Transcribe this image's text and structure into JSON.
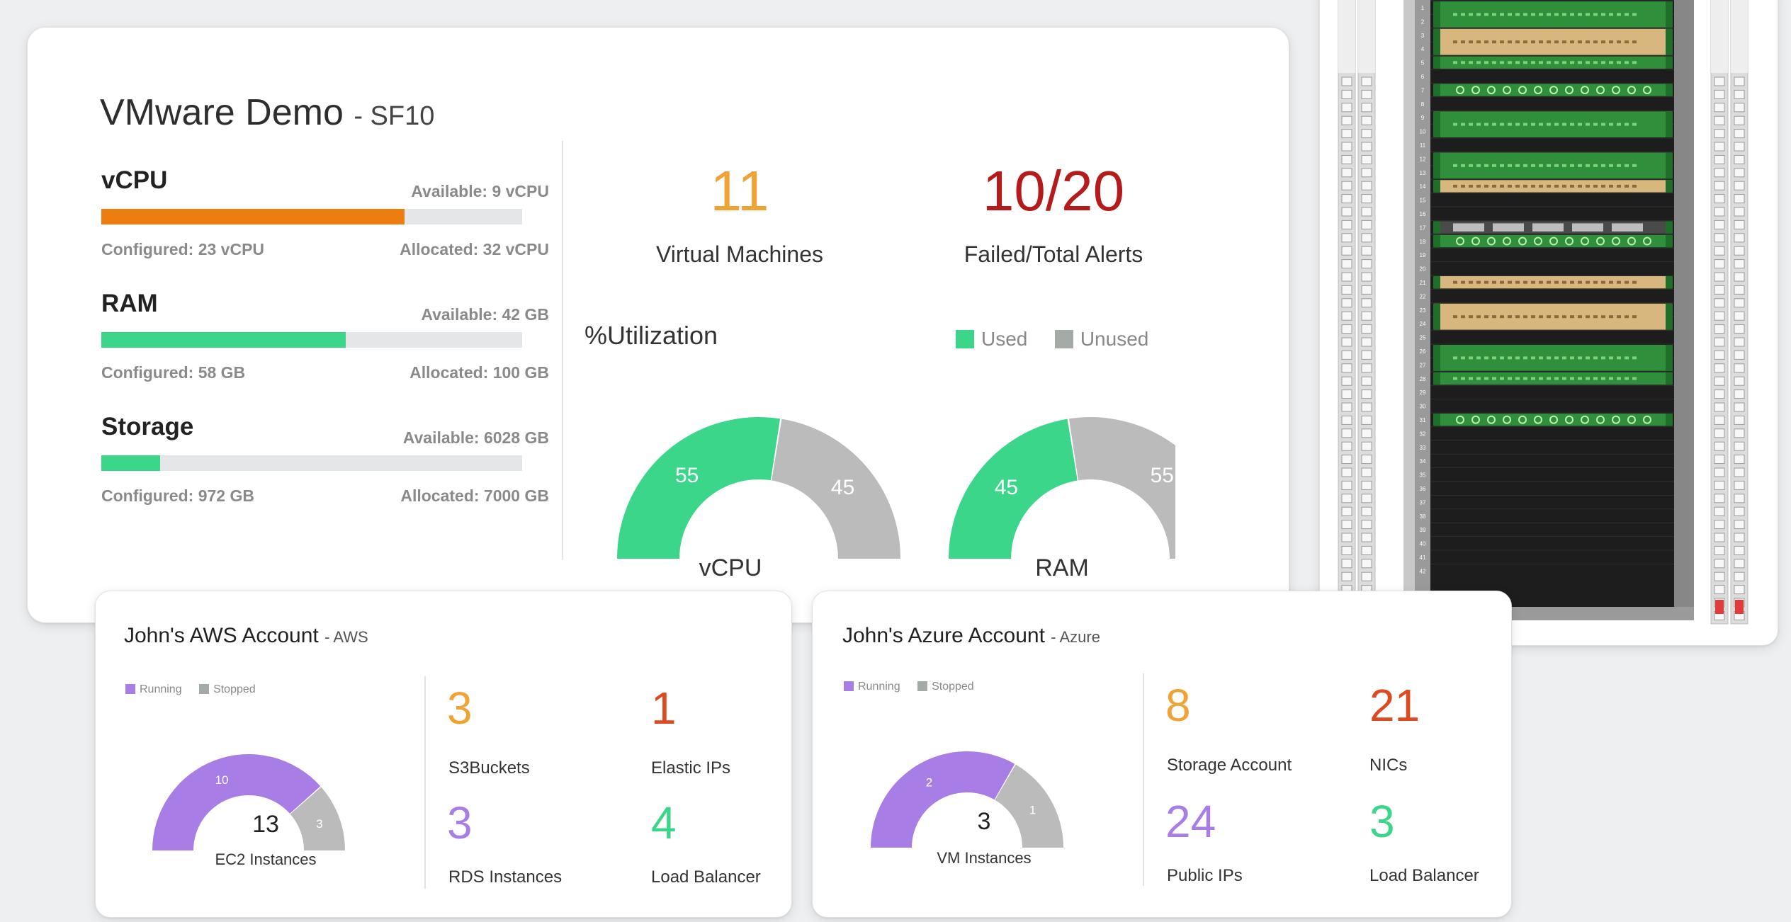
{
  "colors": {
    "orange": "#f0a335",
    "red": "#b61b1b",
    "green": "#3cd68a",
    "gray": "#bbbbbb",
    "purple": "#a87de6",
    "vcpu_bar": "#ee7d10",
    "stat_red": "#de4a20",
    "stat_green": "#3cd68a"
  },
  "vmware": {
    "title": "VMware Demo",
    "subtitle": "- SF10",
    "resources": [
      {
        "name": "vCPU",
        "available": "Available: 9 vCPU",
        "configured": "Configured: 23 vCPU",
        "allocated": "Allocated: 32 vCPU",
        "fill_fraction": 0.72,
        "color": "#ee7d10"
      },
      {
        "name": "RAM",
        "available": "Available: 42 GB",
        "configured": "Configured: 58 GB",
        "allocated": "Allocated: 100 GB",
        "fill_fraction": 0.58,
        "color": "#3cd68a"
      },
      {
        "name": "Storage",
        "available": "Available: 6028 GB",
        "configured": "Configured: 972 GB",
        "allocated": "Allocated: 7000 GB",
        "fill_fraction": 0.14,
        "color": "#3cd68a"
      }
    ],
    "vm_count": "11",
    "vm_label": "Virtual Machines",
    "alerts": "10/20",
    "alerts_label": "Failed/Total Alerts",
    "utilization_title": "%Utilization",
    "legend": {
      "used": "Used",
      "unused": "Unused"
    },
    "gauges": [
      {
        "label": "vCPU",
        "used": 55,
        "unused": 45,
        "used_label": "55",
        "unused_label": "45"
      },
      {
        "label": "RAM",
        "used": 45,
        "unused": 55,
        "used_label": "45",
        "unused_label": "55"
      }
    ]
  },
  "aws": {
    "title": "John's AWS Account",
    "subtitle": "- AWS",
    "legend": {
      "running": "Running",
      "stopped": "Stopped"
    },
    "gauge": {
      "running": 10,
      "stopped": 3,
      "running_label": "10",
      "stopped_label": "3",
      "total": "13",
      "label": "EC2 Instances"
    },
    "stats": [
      {
        "value": "3",
        "label": "S3Buckets",
        "color": "#f0a335"
      },
      {
        "value": "1",
        "label": "Elastic IPs",
        "color": "#de4a20"
      },
      {
        "value": "3",
        "label": "RDS Instances",
        "color": "#a87de6"
      },
      {
        "value": "4",
        "label": "Load Balancer",
        "color": "#3cd68a"
      }
    ]
  },
  "azure": {
    "title": "John's Azure Account",
    "subtitle": "- Azure",
    "legend": {
      "running": "Running",
      "stopped": "Stopped"
    },
    "gauge": {
      "running": 2,
      "stopped": 1,
      "running_label": "2",
      "stopped_label": "1",
      "total": "3",
      "label": "VM Instances"
    },
    "stats": [
      {
        "value": "8",
        "label": "Storage Account",
        "color": "#f0a335"
      },
      {
        "value": "21",
        "label": "NICs",
        "color": "#de4a20"
      },
      {
        "value": "24",
        "label": "Public IPs",
        "color": "#a87de6"
      },
      {
        "value": "3",
        "label": "Load Balancer",
        "color": "#3cd68a"
      }
    ]
  },
  "rack": {
    "unit_numbers": [
      "1",
      "2",
      "3",
      "4",
      "5",
      "6",
      "7",
      "8",
      "9",
      "10",
      "11",
      "12",
      "13",
      "14",
      "15",
      "16",
      "17",
      "18",
      "19",
      "20",
      "21",
      "22",
      "23",
      "24",
      "25",
      "26",
      "27",
      "28",
      "29",
      "30",
      "31",
      "32",
      "33",
      "34",
      "35",
      "36",
      "37",
      "38",
      "39",
      "40",
      "41",
      "42"
    ]
  }
}
